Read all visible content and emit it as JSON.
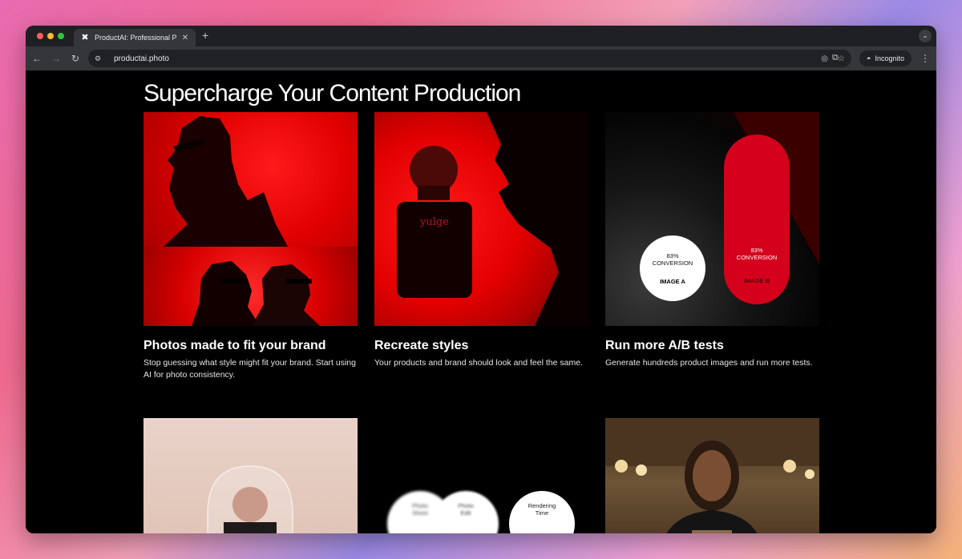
{
  "browser": {
    "tab_title": "ProductAI: Professional Produ",
    "tab_close": "✕",
    "new_tab": "+",
    "url": "productai.photo",
    "incognito_label": "Incognito"
  },
  "page": {
    "heading": "Supercharge Your Content Production",
    "cards": [
      {
        "title": "Photos made to fit your brand",
        "description": "Stop guessing what style might fit your brand. Start using AI for photo consistency."
      },
      {
        "title": "Recreate styles",
        "description": "Your products and brand should look and feel the same."
      },
      {
        "title": "Run more A/B tests",
        "description": "Generate hundreds product images and run more tests.",
        "ab": {
          "a_conversion": "83%",
          "a_conversion_label": "CONVERSION",
          "a_label": "IMAGE A",
          "b_conversion": "83%",
          "b_conversion_label": "CONVERSION",
          "b_label": "IMAGE B"
        }
      }
    ],
    "perfume_brand": "yulge",
    "bubbles": [
      {
        "label_line1": "Photo",
        "label_line2": "Shoot"
      },
      {
        "label_line1": "Photo",
        "label_line2": "Edit"
      },
      {
        "label_line1": "Rendering",
        "label_line2": "Time"
      }
    ]
  },
  "colors": {
    "accent_red": "#d4001c",
    "chat_green": "#52d79b"
  },
  "icons": [
    "back-arrow-icon",
    "forward-arrow-icon",
    "reload-icon",
    "site-info-icon",
    "eye-off-icon",
    "star-icon",
    "extensions-icon",
    "incognito-icon",
    "menu-icon",
    "chat-icon"
  ]
}
